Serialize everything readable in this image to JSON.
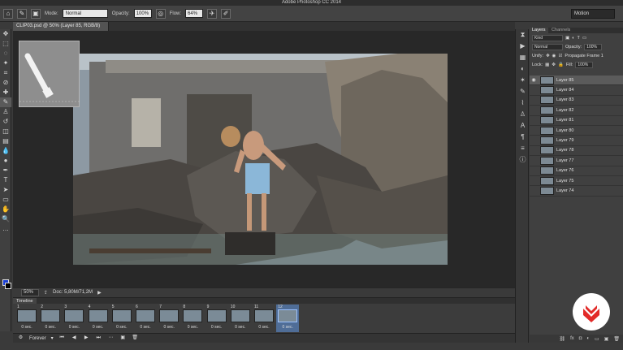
{
  "app": {
    "title": "Adobe Photoshop CC 2014",
    "workspace": "Motion"
  },
  "options": {
    "mode_label": "Mode:",
    "mode_value": "Normal",
    "opacity_label": "Opacity:",
    "opacity_value": "100%",
    "flow_label": "Flow:",
    "flow_value": "64%"
  },
  "document": {
    "tab": "CLIP03.psd @ 50% (Layer 85, RGB/8)"
  },
  "status": {
    "zoom": "50%",
    "doc": "Doc: 5,80M/71,2M"
  },
  "timeline": {
    "title": "Timeline",
    "loop": "Forever",
    "frames": [
      {
        "num": "1",
        "delay": "0 sec."
      },
      {
        "num": "2",
        "delay": "0 sec."
      },
      {
        "num": "3",
        "delay": "0 sec."
      },
      {
        "num": "4",
        "delay": "0 sec."
      },
      {
        "num": "5",
        "delay": "0 sec."
      },
      {
        "num": "6",
        "delay": "0 sec."
      },
      {
        "num": "7",
        "delay": "0 sec."
      },
      {
        "num": "8",
        "delay": "0 sec."
      },
      {
        "num": "9",
        "delay": "0 sec."
      },
      {
        "num": "10",
        "delay": "0 sec."
      },
      {
        "num": "11",
        "delay": "0 sec."
      },
      {
        "num": "12",
        "delay": "0 sec."
      }
    ],
    "selected_frame": "12"
  },
  "layers_panel": {
    "tabs": [
      "Layers",
      "Channels"
    ],
    "filter": "Kind",
    "blend": "Normal",
    "opacity_label": "Opacity:",
    "opacity_value": "100%",
    "unify_label": "Unify:",
    "propagate_label": "Propagate Frame 1",
    "lock_label": "Lock:",
    "fill_label": "Fill:",
    "fill_value": "100%",
    "layers": [
      "Layer 85",
      "Layer 84",
      "Layer 83",
      "Layer 82",
      "Layer 81",
      "Layer 80",
      "Layer 79",
      "Layer 78",
      "Layer 77",
      "Layer 76",
      "Layer 75",
      "Layer 74"
    ]
  },
  "colors": {
    "foreground": "#1a3fd6",
    "background": "#000000",
    "logo_accent": "#e22a28"
  }
}
